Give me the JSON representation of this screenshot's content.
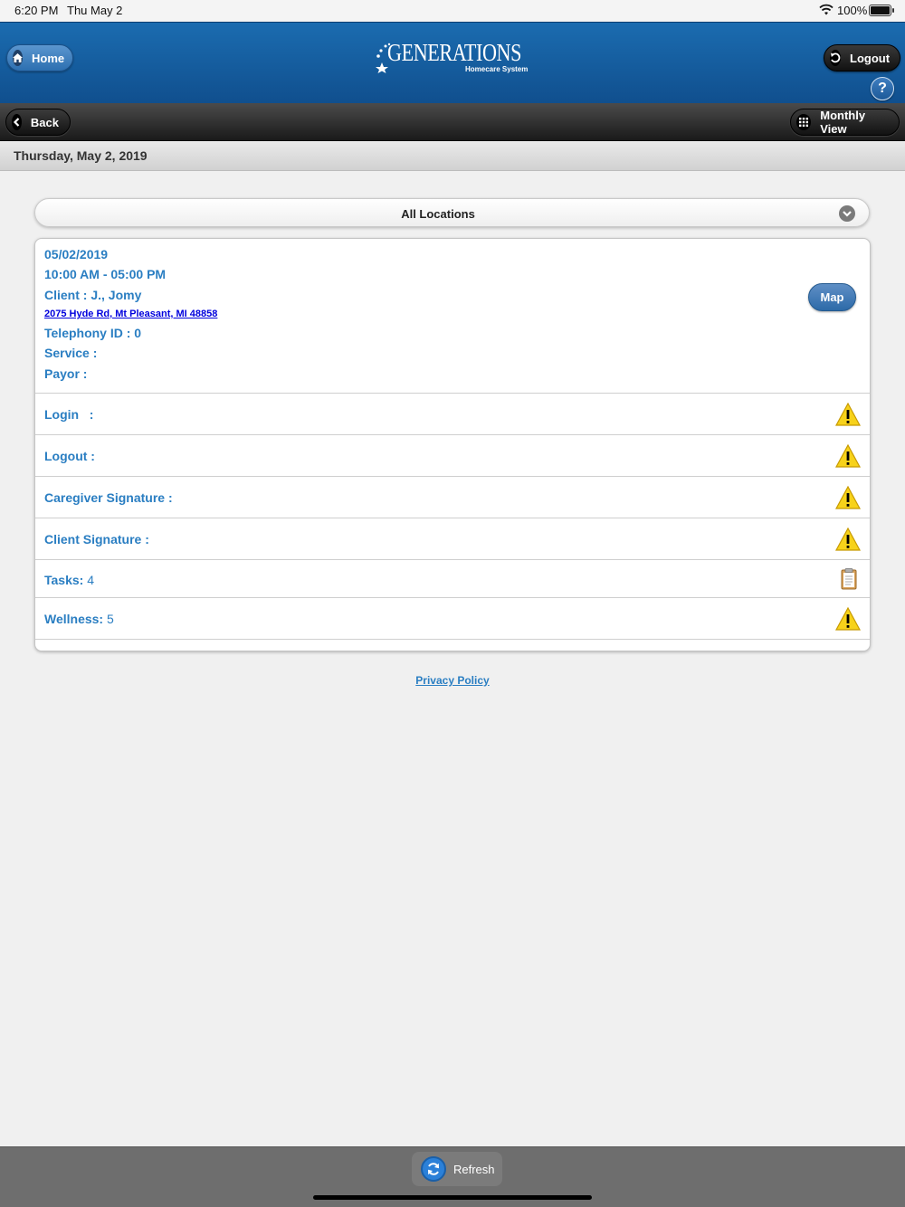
{
  "status_bar": {
    "time": "6:20 PM",
    "date": "Thu May 2",
    "battery": "100%"
  },
  "header": {
    "home_label": "Home",
    "logo_text": "GENERATIONS",
    "logo_subtitle": "Homecare System",
    "logout_label": "Logout",
    "help_label": "?"
  },
  "nav": {
    "back_label": "Back",
    "monthly_label": "Monthly View"
  },
  "date_bar": {
    "date": "Thursday, May 2, 2019"
  },
  "locations": {
    "selected": "All Locations"
  },
  "visit": {
    "date": "05/02/2019",
    "time": "10:00 AM - 05:00 PM",
    "client": "Client : J., Jomy",
    "address": "2075 Hyde Rd, Mt Pleasant, MI 48858",
    "telephony": "Telephony ID : 0",
    "service": "Service :",
    "payor": "Payor :",
    "map_label": "Map"
  },
  "rows": [
    {
      "label": "Login   :",
      "value": "",
      "icon": "warning-icon"
    },
    {
      "label": "Logout :",
      "value": "",
      "icon": "warning-icon"
    },
    {
      "label": "Caregiver Signature :",
      "value": "",
      "icon": "warning-icon"
    },
    {
      "label": "Client Signature :",
      "value": "",
      "icon": "warning-icon"
    },
    {
      "label": "Tasks:",
      "value": " 4",
      "icon": "clipboard-icon"
    },
    {
      "label": "Wellness:",
      "value": " 5",
      "icon": "warning-icon"
    }
  ],
  "footer": {
    "privacy_label": "Privacy Policy",
    "refresh_label": "Refresh"
  },
  "colors": {
    "header_blue": "#1b6cb0",
    "label_blue": "#2a7ec2",
    "warning_yellow": "#f7d21a"
  }
}
